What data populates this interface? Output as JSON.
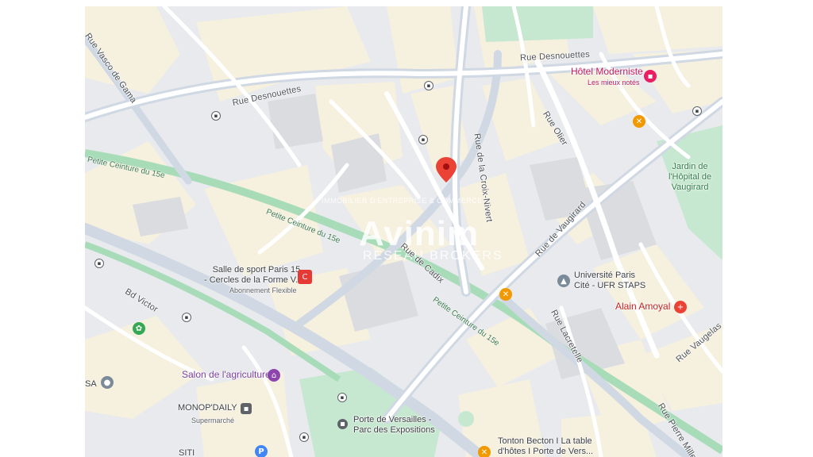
{
  "map": {
    "streets": {
      "rue_desnouettes_top": "Rue Desnouettes",
      "rue_desnouettes_left": "Rue Desnouettes",
      "vasco_de_gama": "Rue Vasco de Gama",
      "rue_olier": "Rue Olier",
      "croix_nivert": "Rue de la Croix-Nivert",
      "rue_de_vaugirard": "Rue de Vaugirard",
      "rue_de_cadix": "Rue de Cadix",
      "bd_victor": "Bd Victor",
      "rue_lacretelle": "Rue Lacretelle",
      "rue_vaugelas": "Rue Vaugelas",
      "rue_pierre_mille": "Rue Pierre Mille"
    },
    "rail": {
      "petite_ceinture_1": "Petite Ceinture du 15e",
      "petite_ceinture_2": "Petite Ceinture du 15e",
      "petite_ceinture_3": "Petite Ceinture du 15e"
    },
    "pois": {
      "hotel_name": "Hôtel Moderniste",
      "hotel_sub": "Les mieux notés",
      "jardin": "Jardin de\nl'Hôpital de\nVaugirard",
      "universite": "Université Paris\nCité - UFR STAPS",
      "alain": "Alain Amoyal",
      "salle_sport": "Salle de sport Paris 15\n- Cercles de la Forme V..",
      "salle_sub": "Abonnement Flexible",
      "salon": "Salon de l'agriculture",
      "monop": "MONOP'DAILY",
      "monop_sub": "Supermarché",
      "porte": "Porte de Versailles -\nParc des Expositions",
      "tonton": "Tonton Becton I La table\nd'hôtes I Porte de Vers...",
      "sa": "SA",
      "siti": "SITI"
    },
    "watermark": {
      "brand": "Avinim",
      "tagline": "RÉSEAU BROKERS",
      "small": "IMMOBILIER D'ENTREPRISE & COMMERCE"
    },
    "icons": {
      "location_pin": "location-pin-icon",
      "bus": "bus-stop-icon",
      "restaurant": "restaurant-icon",
      "hospital": "hospital-icon",
      "university": "university-icon",
      "gym": "gym-icon",
      "store": "store-icon",
      "parking": "parking-icon"
    },
    "colors": {
      "road": "#ffffff",
      "major_road": "#cfd8e3",
      "block": "#f5f0e1",
      "park": "#bfe5c9",
      "rail": "#9fd7b0",
      "pin": "#ea4335"
    }
  }
}
